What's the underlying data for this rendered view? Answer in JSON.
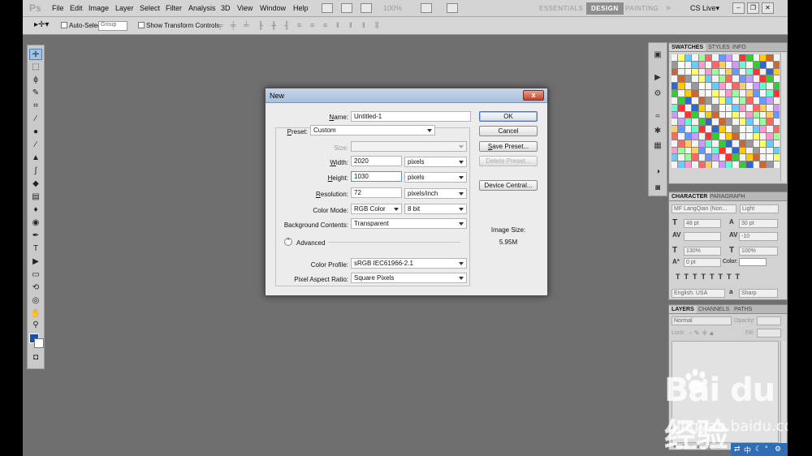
{
  "menubar": {
    "logo": "Ps",
    "items": [
      "File",
      "Edit",
      "Image",
      "Layer",
      "Select",
      "Filter",
      "Analysis",
      "3D",
      "View",
      "Window",
      "Help"
    ],
    "zoom": "100%",
    "workspaces": [
      "ESSENTIALS",
      "DESIGN",
      "PAINTING"
    ],
    "more": "»",
    "cs_live": "CS Live▾"
  },
  "options": {
    "auto_select_label": "Auto-Select:",
    "auto_select_value": "Group",
    "transform_label": "Show Transform Controls"
  },
  "dialog": {
    "title": "New",
    "close": "x",
    "name_label": "Name:",
    "name_value": "Untitled-1",
    "preset_label": "Preset:",
    "preset_value": "Custom",
    "size_label": "Size:",
    "width_label": "Width:",
    "width_value": "2020",
    "width_unit": "pixels",
    "height_label": "Height:",
    "height_value": "1030",
    "height_unit": "pixels",
    "resolution_label": "Resolution:",
    "resolution_value": "72",
    "resolution_unit": "pixels/inch",
    "color_mode_label": "Color Mode:",
    "color_mode_value": "RGB Color",
    "bit_depth": "8 bit",
    "bg_label": "Background Contents:",
    "bg_value": "Transparent",
    "advanced_label": "Advanced",
    "profile_label": "Color Profile:",
    "profile_value": "sRGB IEC61966-2.1",
    "pixel_aspect_label": "Pixel Aspect Ratio:",
    "pixel_aspect_value": "Square Pixels",
    "ok": "OK",
    "cancel": "Cancel",
    "save_preset": "Save Preset...",
    "delete_preset": "Delete Preset...",
    "device_central": "Device Central...",
    "image_size_label": "Image Size:",
    "image_size_value": "5.95M"
  },
  "swatches": {
    "tabs": [
      "SWATCHES",
      "STYLES",
      "INFO"
    ]
  },
  "character": {
    "tabs": [
      "CHARACTER",
      "PARAGRAPH"
    ],
    "font": "MF LangQian (Non...",
    "style": "Light",
    "size": "48 pt",
    "leading": "30 pt",
    "tracking": "-10",
    "vscale": "130%",
    "hscale": "100%",
    "baseline": "0 pt",
    "color_label": "Color:",
    "language": "English: USA",
    "aa_label": "a",
    "aa": "Sharp"
  },
  "layers": {
    "tabs": [
      "LAYERS",
      "CHANNELS",
      "PATHS"
    ],
    "blend": "Normal",
    "opacity_label": "Opacity:",
    "lock_label": "Lock:",
    "fill_label": "Fill:"
  },
  "tray": {
    "lang": "中"
  },
  "watermark": {
    "logo": "Bai du 经验",
    "url": "jingyan.baidu.com"
  }
}
